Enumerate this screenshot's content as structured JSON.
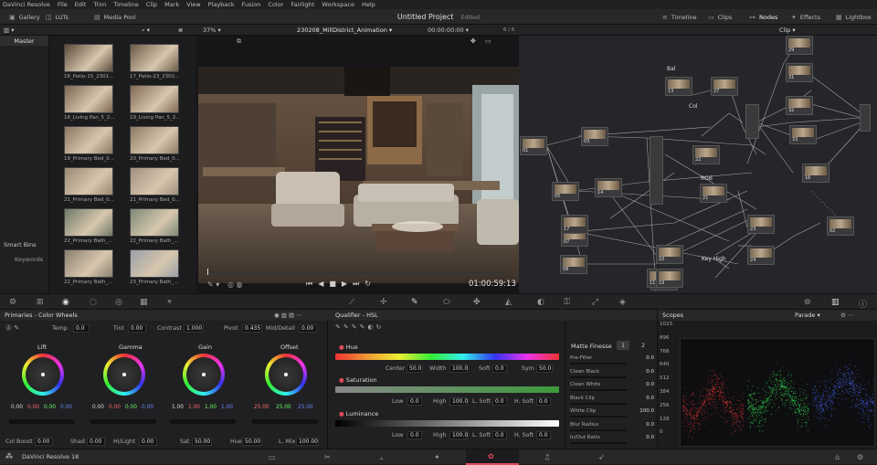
{
  "menu": [
    "DaVinci Resolve",
    "File",
    "Edit",
    "Trim",
    "Timeline",
    "Clip",
    "Mark",
    "View",
    "Playback",
    "Fusion",
    "Color",
    "Fairlight",
    "Workspace",
    "Help"
  ],
  "topbar": {
    "gallery": "Gallery",
    "luts": "LUTs",
    "media_pool": "Media Pool",
    "project_title": "Untitled Project",
    "project_status": "Edited",
    "timeline": "Timeline",
    "clips": "Clips",
    "nodes": "Nodes",
    "effects": "Effects",
    "lightbox": "Lightbox"
  },
  "subbar": {
    "zoom": "37%",
    "timeline_name": "230208_MillDistrict_Animation",
    "timecode": "00:00:00:00",
    "clip_count": "6 / 6",
    "node_mode": "Clip"
  },
  "left": {
    "master": "Master",
    "smart_bins": "Smart Bins",
    "keywords": "Keywords"
  },
  "clips": [
    {
      "label": "16_Patio-15_2301...",
      "bg": "#5a4a3a"
    },
    {
      "label": "17_Patio-23_2302...",
      "bg": "#6b5a48"
    },
    {
      "label": "18_Living Pan_5_2...",
      "bg": "#7a6552"
    },
    {
      "label": "19_Living Pan_5_2...",
      "bg": "#806a55"
    },
    {
      "label": "19_Primary Bed_0...",
      "bg": "#8a7762"
    },
    {
      "label": "20_Primary Bed_0...",
      "bg": "#8d7a64"
    },
    {
      "label": "21_Primary Bed_0...",
      "bg": "#9a8874"
    },
    {
      "label": "21_Primary Bed_0...",
      "bg": "#a09080"
    },
    {
      "label": "22_Primary Bath_...",
      "bg": "#6f7a6a"
    },
    {
      "label": "22_Primary Bath_...",
      "bg": "#7b8a78"
    },
    {
      "label": "22_Primary Bath_...",
      "bg": "#8a8070"
    },
    {
      "label": "23_Primary Bath_...",
      "bg": "#9aa0a8"
    }
  ],
  "viewer": {
    "timecode": "01:00:59:13"
  },
  "nodes": [
    {
      "id": "01"
    },
    {
      "id": "03"
    },
    {
      "id": "05"
    },
    {
      "id": "07"
    },
    {
      "id": "08"
    },
    {
      "id": "09"
    },
    {
      "id": "10"
    },
    {
      "id": "11"
    },
    {
      "id": "13"
    },
    {
      "id": "14"
    },
    {
      "id": "16"
    },
    {
      "id": "17"
    },
    {
      "id": "19"
    },
    {
      "id": "21"
    },
    {
      "id": "22"
    },
    {
      "id": "23"
    },
    {
      "id": "24"
    },
    {
      "id": "27"
    },
    {
      "id": "29"
    },
    {
      "id": "31"
    },
    {
      "id": "32"
    },
    {
      "id": "33"
    },
    {
      "id": "02"
    }
  ],
  "node_labels": {
    "bal": "Bal",
    "col": "Col",
    "rgb": "RGB",
    "keyhigh": "Key High"
  },
  "primaries": {
    "title": "Primaries - Color Wheels",
    "temp_label": "Temp",
    "temp": "0.0",
    "tint_label": "Tint",
    "tint": "0.00",
    "contrast_label": "Contrast",
    "contrast": "1.000",
    "pivot_label": "Pivot",
    "pivot": "0.435",
    "middetail_label": "Mid/Detail",
    "middetail": "0.00",
    "wheels": [
      {
        "name": "Lift",
        "values": [
          "0.00",
          "0.00",
          "0.00",
          "0.00"
        ]
      },
      {
        "name": "Gamma",
        "values": [
          "0.00",
          "0.00",
          "0.00",
          "0.00"
        ]
      },
      {
        "name": "Gain",
        "values": [
          "1.00",
          "1.00",
          "1.00",
          "1.00"
        ]
      },
      {
        "name": "Offset",
        "values": [
          "25.00",
          "25.00",
          "25.00"
        ]
      }
    ],
    "colboost_label": "Col Boost",
    "colboost": "0.00",
    "shad_label": "Shad",
    "shad": "0.00",
    "hilight_label": "Hi/Light",
    "hilight": "0.00",
    "sat_label": "Sat",
    "sat": "50.00",
    "hue_label": "Hue",
    "hue": "50.00",
    "lmix_label": "L. Mix",
    "lmix": "100.00"
  },
  "qualifier": {
    "title": "Qualifier - HSL",
    "hue": "Hue",
    "saturation": "Saturation",
    "luminance": "Luminance",
    "center_label": "Center",
    "center": "50.0",
    "width_label": "Width",
    "width": "100.0",
    "soft_label": "Soft",
    "soft": "0.0",
    "sym_label": "Sym",
    "sym": "50.0",
    "low_label": "Low",
    "low": "0.0",
    "high_label": "High",
    "high": "100.0",
    "lsoft_label": "L. Soft",
    "lsoft": "0.0",
    "hsoft_label": "H. Soft",
    "hsoft": "0.0"
  },
  "matte": {
    "title": "Matte Finesse",
    "tab1": "1",
    "tab2": "2",
    "rows": [
      {
        "label": "Pre-Filter",
        "value": "0.0"
      },
      {
        "label": "Clean Black",
        "value": "0.0"
      },
      {
        "label": "Clean White",
        "value": "0.0"
      },
      {
        "label": "Black Clip",
        "value": "0.0"
      },
      {
        "label": "White Clip",
        "value": "100.0"
      },
      {
        "label": "Blur Radius",
        "value": "0.0"
      },
      {
        "label": "In/Out Ratio",
        "value": "0.0"
      }
    ]
  },
  "scopes": {
    "title": "Scopes",
    "mode": "Parade",
    "ticks": [
      "1023",
      "896",
      "768",
      "640",
      "512",
      "384",
      "256",
      "128",
      "0"
    ]
  },
  "bottom": {
    "app": "DaVinci Resolve 18"
  },
  "colors": {
    "accent": "#e34a5a",
    "red_trace": "#ff3a3a",
    "green_trace": "#3aff5a",
    "blue_trace": "#4a6aff"
  }
}
